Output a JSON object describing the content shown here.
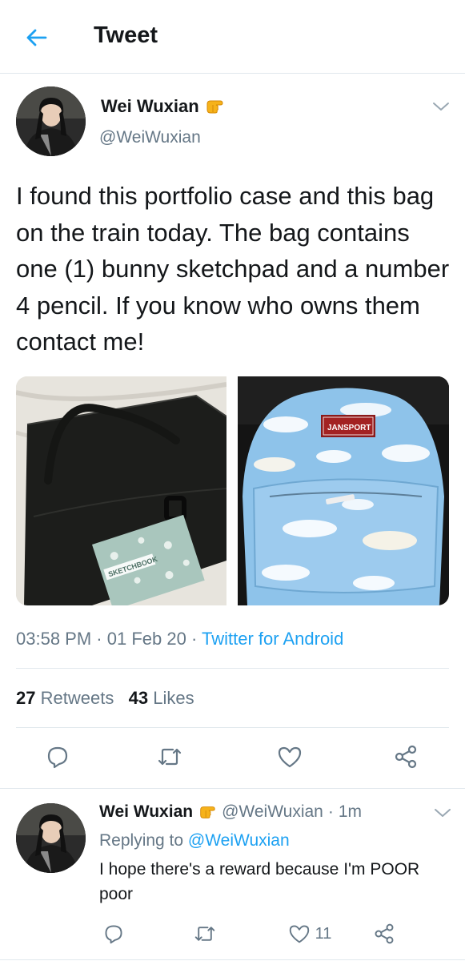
{
  "header": {
    "title": "Tweet",
    "back_icon": "arrow-left-icon"
  },
  "tweet": {
    "author_name": "Wei Wuxian",
    "handle": "@WeiWuxian",
    "badge_icon": "pointing-hand-emoji-icon",
    "text": "I found this portfolio case and this bag on the train today. The bag contains one (1) bunny sketchpad and a number 4 pencil. If you know who owns them contact me!",
    "media": [
      {
        "name": "black-portfolio-case-photo",
        "sketchbook_label": "SKETCHBOOK"
      },
      {
        "name": "cloud-backpack-photo",
        "brand_label": "JANSPORT"
      }
    ],
    "time": "03:58 PM",
    "date": "01 Feb 20",
    "sep": "·",
    "source": "Twitter for Android",
    "retweets_count": "27",
    "retweets_label": "Retweets",
    "likes_count": "43",
    "likes_label": "Likes",
    "actions": [
      "reply-icon",
      "retweet-icon",
      "like-icon",
      "share-icon"
    ]
  },
  "reply": {
    "author_name": "Wei Wuxian",
    "handle": "@WeiWuxian",
    "sep": "·",
    "time": "1m",
    "replying_label": "Replying to",
    "replying_handle": "@WeiWuxian",
    "text": "I hope there's a reward because I'm POOR poor",
    "likes_count": "11"
  },
  "colors": {
    "accent": "#1da1f2",
    "secondary_text": "#657786",
    "primary_text": "#14171a",
    "divider": "#e1e8ed"
  }
}
